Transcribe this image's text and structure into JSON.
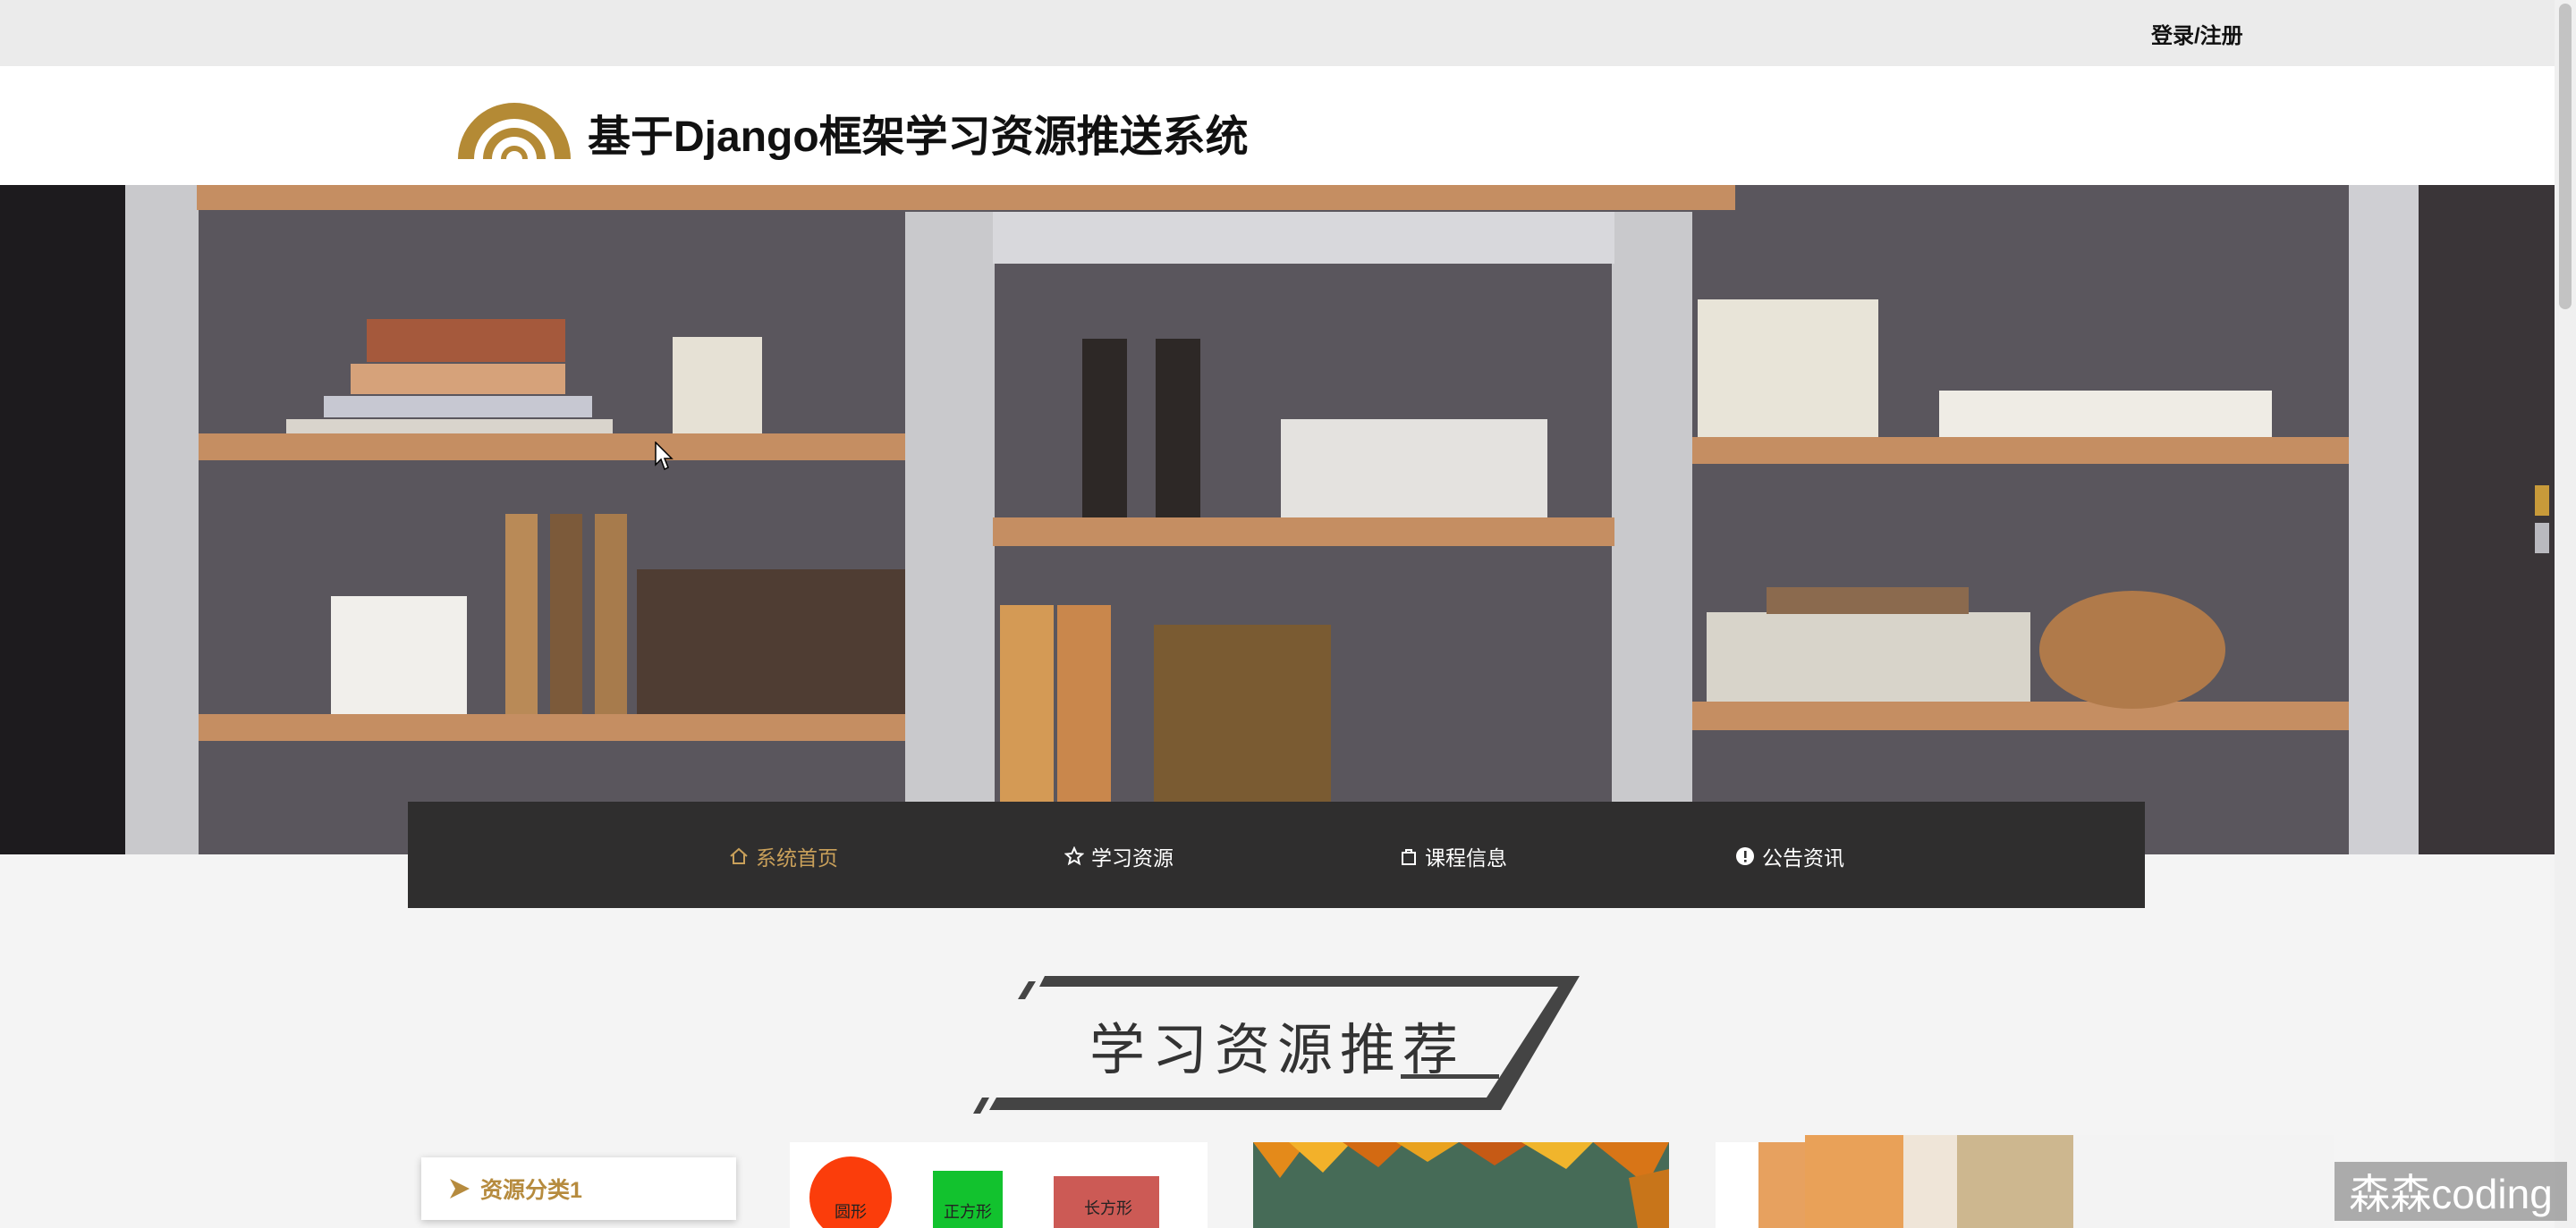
{
  "top_bar": {
    "login_label": "登录/注册"
  },
  "header": {
    "site_title": "基于Django框架学习资源推送系统"
  },
  "nav": {
    "items": [
      {
        "label": "系统首页",
        "icon": "home-icon",
        "active": true
      },
      {
        "label": "学习资源",
        "icon": "star-icon",
        "active": false
      },
      {
        "label": "课程信息",
        "icon": "bag-icon",
        "active": false
      },
      {
        "label": "公告资讯",
        "icon": "info-icon",
        "active": false
      }
    ]
  },
  "section": {
    "title": "学习资源推荐"
  },
  "categories": [
    {
      "label": "资源分类1",
      "icon": "arrow-right-icon"
    }
  ],
  "cards": [
    {
      "shapes": [
        {
          "label": "圆形",
          "color": "#fb3d0b"
        },
        {
          "label": "正方形",
          "color": "#12c22e"
        },
        {
          "label": "长方形",
          "color": "#cc5a55"
        }
      ]
    }
  ],
  "watermark": {
    "text": "森森coding"
  },
  "colors": {
    "accent": "#c9a05a",
    "nav_bg": "#2f2e2e",
    "header_bg": "#ffffff",
    "topbar_bg": "#ebebeb"
  }
}
